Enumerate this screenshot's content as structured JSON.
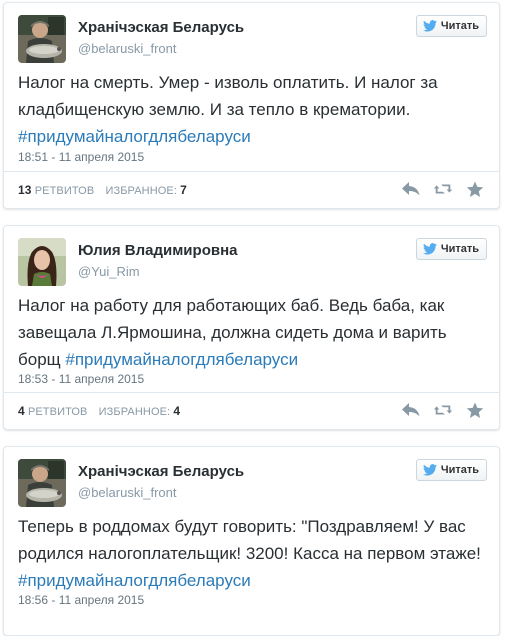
{
  "follow_label": "Читать",
  "labels": {
    "retweets": "ретвитов",
    "favorites": "избранное:"
  },
  "colors": {
    "hashtag": "#2b7bb9",
    "muted": "#8899a6",
    "follow_bird": "#55acee"
  },
  "tweets": [
    {
      "name": "Хранiчэская Беларусь",
      "handle": "@belaruski_front",
      "text": "Налог на смерть. Умер - изволь оплатить. И налог за кладбищенскую землю. И за тепло в крематории. ",
      "hashtag": "#придумайналогдлябеларуси",
      "timestamp": "18:51 - 11 апреля 2015",
      "retweets": "13",
      "favorites": "7",
      "avatar": "man-portrait-with-fish"
    },
    {
      "name": "Юлия Владимировна",
      "handle": "@Yui_Rim",
      "text": "Налог на работу для работающих баб. Ведь баба, как завещала Л.Ярмошина, должна сидеть дома и варить борщ ",
      "hashtag": "#придумайналогдлябеларуси",
      "timestamp": "18:53 - 11 апреля 2015",
      "retweets": "4",
      "favorites": "4",
      "avatar": "woman-portrait"
    },
    {
      "name": "Хранiчэская Беларусь",
      "handle": "@belaruski_front",
      "text": "Теперь в роддомах будут говорить: \"Поздравляем! У вас родился налогоплательщик! 3200! Касса на первом этаже! ",
      "hashtag": "#придумайналогдлябеларуси",
      "timestamp": "18:56 - 11 апреля 2015",
      "avatar": "man-portrait-with-fish"
    }
  ]
}
